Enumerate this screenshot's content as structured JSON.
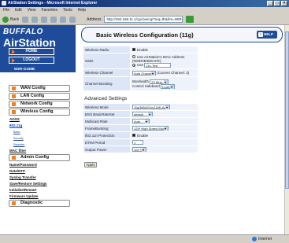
{
  "window": {
    "title": "AirStation Settings - Microsoft Internet Explorer",
    "controls": [
      "_",
      "□",
      "×"
    ]
  },
  "menubar": [
    "File",
    "Edit",
    "View",
    "Favorites",
    "Tools",
    "Help"
  ],
  "toolbar": {
    "back": "Back",
    "address_label": "Address",
    "address_value": "http://192.168.11.1/cgi-bin/cgi?req=tfr&frm=WIRELESS"
  },
  "sidebar": {
    "brand": "BUFFALO",
    "product": "AirStation",
    "tagline": "Wireless LAN Access Point",
    "home": "HOME",
    "logout": "LOGOUT",
    "model": "WZR-G108B",
    "menu": [
      {
        "label": "WAN Config"
      },
      {
        "label": "LAN Config"
      },
      {
        "label": "Network Config"
      }
    ],
    "wireless": "Wireless Config",
    "wireless_sub": [
      "AOSS",
      "802.11g"
    ],
    "wireless_deep": [
      "Basic",
      "Security",
      "Repeater"
    ],
    "mac_filter": "MAC filter",
    "admin": "Admin Config",
    "admin_sub": [
      "Name/Password",
      "Date/NTP",
      "Syslog Transfer",
      "Save/Restore Settings",
      "Initialize/Restart",
      "Firmware Update"
    ],
    "diagnostic": "Diagnostic"
  },
  "main": {
    "title": "Basic Wireless Configuration (11g)",
    "help": "HELP",
    "basic": {
      "radio_label": "Wireless Radio",
      "radio_value": "Enable",
      "ssid_label": "SSID",
      "ssid_opt1": "Use AirStation's MAC Address (000D0B4EEAFE)",
      "ssid_opt2": "Use",
      "ssid_value": "11n-Test",
      "channel_label": "Wireless Channel",
      "channel_value": "Auto Channel",
      "channel_current": "(Current Channel: 3)",
      "bonding_label": "Channel Bonding",
      "bandwidth_label": "Bandwidth",
      "bandwidth_value": "20 MHz",
      "control_label": "Control Sideband",
      "control_value": "Lower"
    },
    "advanced_title": "Advanced Settings",
    "advanced": [
      {
        "label": "Wireless Mode",
        "value": "11g(54M)/11n(11M)-Auto",
        "kind": "select"
      },
      {
        "label": "BSS BasicRateSet",
        "value": "default",
        "kind": "select"
      },
      {
        "label": "Multicast Rate",
        "value": "Auto",
        "kind": "select"
      },
      {
        "label": "FrameBursting",
        "value": "125* High Speed Mode",
        "kind": "select"
      },
      {
        "label": "802.11n Protection",
        "value": "Enable",
        "kind": "check"
      },
      {
        "label": "DTIM Period",
        "value": "1",
        "kind": "text"
      },
      {
        "label": "Output Power",
        "value": "100 %",
        "kind": "select"
      }
    ],
    "apply": "Apply"
  },
  "status": {
    "zone": "Internet"
  },
  "colors": {
    "brand_blue": "#1e4b9a",
    "accent_orange": "#f08020",
    "label_cell": "#dce6f6"
  }
}
